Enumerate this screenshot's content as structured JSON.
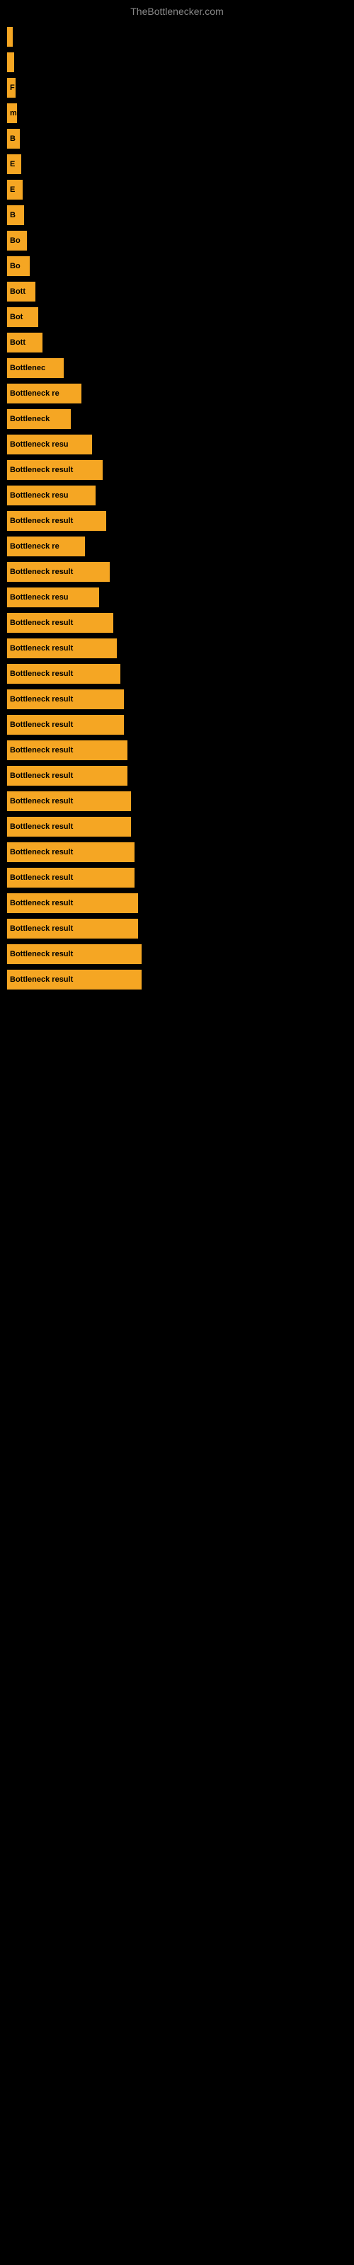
{
  "site_title": "TheBottlenecker.com",
  "bars": [
    {
      "label": "",
      "width": 8
    },
    {
      "label": "",
      "width": 10
    },
    {
      "label": "F",
      "width": 12
    },
    {
      "label": "m",
      "width": 14
    },
    {
      "label": "B",
      "width": 18
    },
    {
      "label": "E",
      "width": 20
    },
    {
      "label": "E",
      "width": 22
    },
    {
      "label": "B",
      "width": 24
    },
    {
      "label": "Bo",
      "width": 28
    },
    {
      "label": "Bo",
      "width": 32
    },
    {
      "label": "Bott",
      "width": 40
    },
    {
      "label": "Bot",
      "width": 44
    },
    {
      "label": "Bott",
      "width": 50
    },
    {
      "label": "Bottlenec",
      "width": 80
    },
    {
      "label": "Bottleneck re",
      "width": 105
    },
    {
      "label": "Bottleneck",
      "width": 90
    },
    {
      "label": "Bottleneck resu",
      "width": 120
    },
    {
      "label": "Bottleneck result",
      "width": 135
    },
    {
      "label": "Bottleneck resu",
      "width": 125
    },
    {
      "label": "Bottleneck result",
      "width": 140
    },
    {
      "label": "Bottleneck re",
      "width": 110
    },
    {
      "label": "Bottleneck result",
      "width": 145
    },
    {
      "label": "Bottleneck resu",
      "width": 130
    },
    {
      "label": "Bottleneck result",
      "width": 150
    },
    {
      "label": "Bottleneck result",
      "width": 155
    },
    {
      "label": "Bottleneck result",
      "width": 160
    },
    {
      "label": "Bottleneck result",
      "width": 165
    },
    {
      "label": "Bottleneck result",
      "width": 165
    },
    {
      "label": "Bottleneck result",
      "width": 170
    },
    {
      "label": "Bottleneck result",
      "width": 170
    },
    {
      "label": "Bottleneck result",
      "width": 175
    },
    {
      "label": "Bottleneck result",
      "width": 175
    },
    {
      "label": "Bottleneck result",
      "width": 180
    },
    {
      "label": "Bottleneck result",
      "width": 180
    },
    {
      "label": "Bottleneck result",
      "width": 185
    },
    {
      "label": "Bottleneck result",
      "width": 185
    },
    {
      "label": "Bottleneck result",
      "width": 190
    },
    {
      "label": "Bottleneck result",
      "width": 190
    }
  ]
}
